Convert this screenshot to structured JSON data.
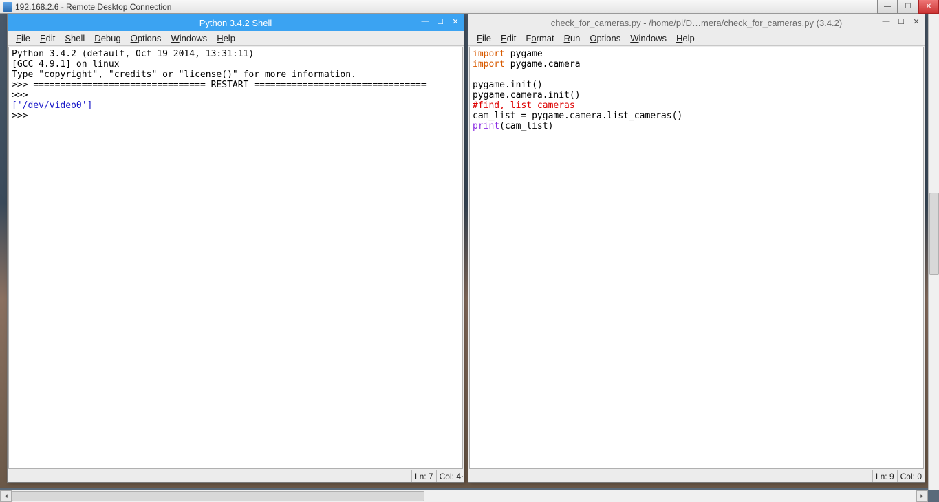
{
  "rdp": {
    "title": "192.168.2.6 - Remote Desktop Connection"
  },
  "shell": {
    "title": "Python 3.4.2 Shell",
    "menus": {
      "file": "File",
      "edit": "Edit",
      "shell": "Shell",
      "debug": "Debug",
      "options": "Options",
      "windows": "Windows",
      "help": "Help"
    },
    "lines": {
      "l1": "Python 3.4.2 (default, Oct 19 2014, 13:31:11)",
      "l2": "[GCC 4.9.1] on linux",
      "l3": "Type \"copyright\", \"credits\" or \"license()\" for more information.",
      "l4a": ">>> ",
      "l4b": "================================ RESTART ================================",
      "l5": ">>> ",
      "l6": "['/dev/video0']",
      "l7": ">>> "
    },
    "status": {
      "ln": "Ln: 7",
      "col": "Col: 4"
    }
  },
  "editor": {
    "title": "check_for_cameras.py - /home/pi/D…mera/check_for_cameras.py (3.4.2)",
    "menus": {
      "file": "File",
      "edit": "Edit",
      "format": "Format",
      "run": "Run",
      "options": "Options",
      "windows": "Windows",
      "help": "Help"
    },
    "code": {
      "kw_import1": "import",
      "mod1": " pygame",
      "kw_import2": "import",
      "mod2": " pygame.camera",
      "blank": "",
      "l4": "pygame.init()",
      "l5": "pygame.camera.init()",
      "comment": "#find, list cameras",
      "l7": "cam_list = pygame.camera.list_cameras()",
      "print_kw": "print",
      "print_arg": "(cam_list)"
    },
    "status": {
      "ln": "Ln: 9",
      "col": "Col: 0"
    }
  }
}
